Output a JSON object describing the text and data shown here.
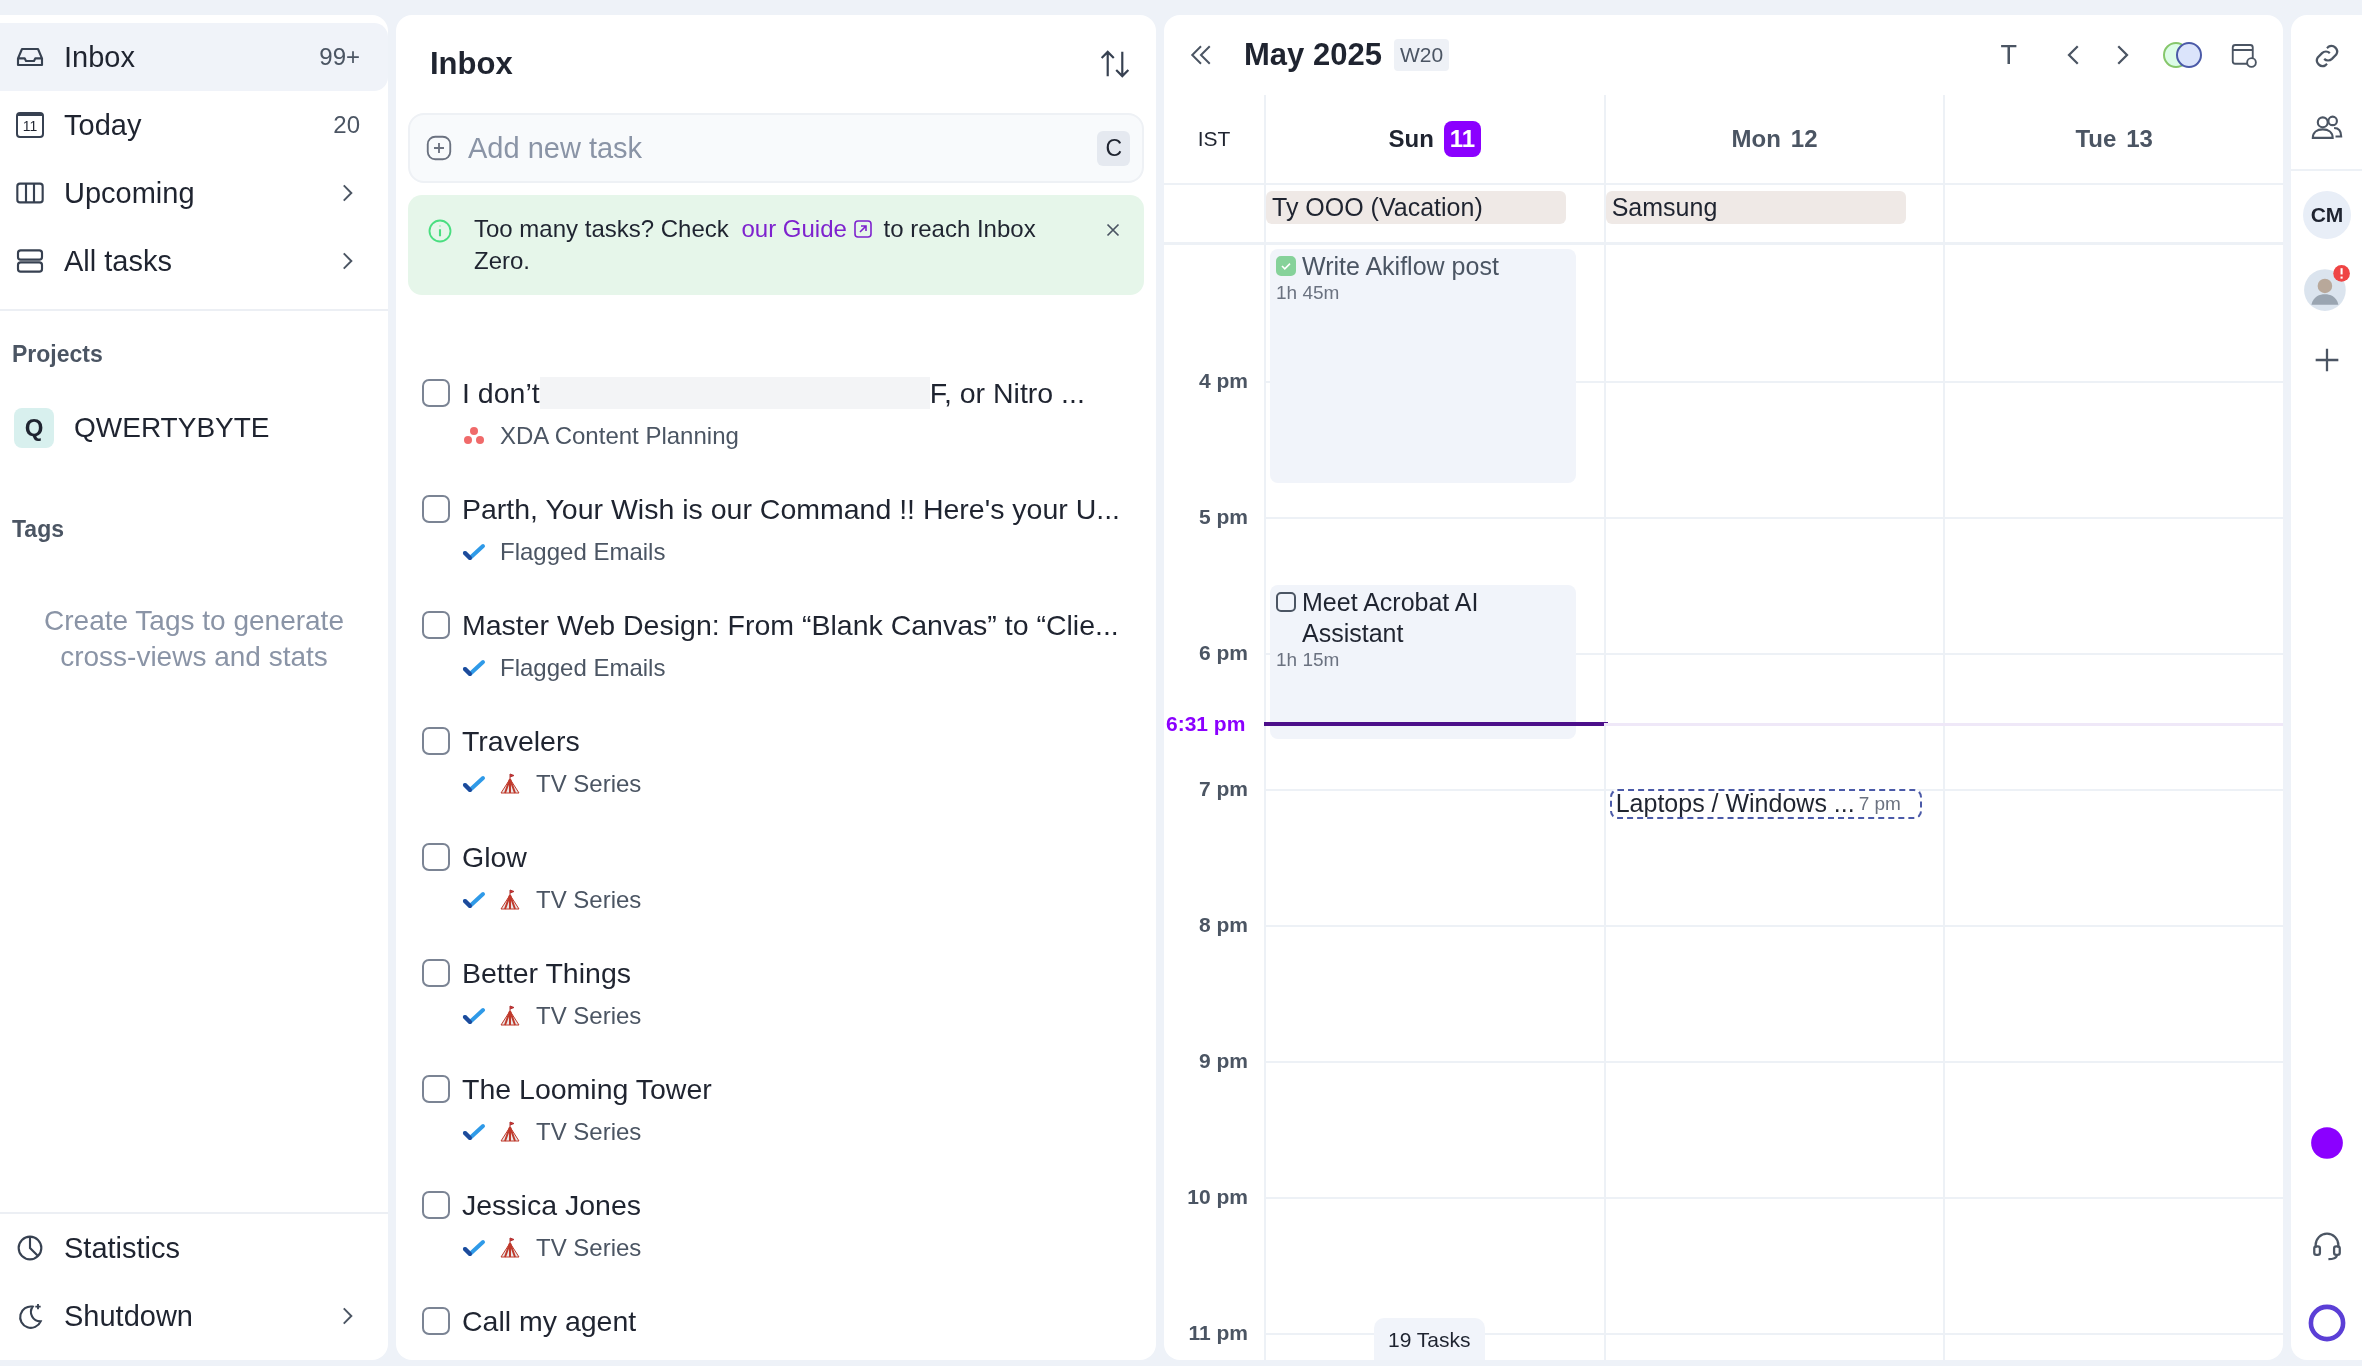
{
  "sidebar": {
    "nav": [
      {
        "label": "Inbox",
        "count": "99+",
        "selected": true
      },
      {
        "label": "Today",
        "icon_text": "11",
        "count": "20",
        "selected": false
      },
      {
        "label": "Upcoming",
        "has_submenu": true,
        "selected": false
      },
      {
        "label": "All tasks",
        "has_submenu": true,
        "selected": false
      }
    ],
    "projects_heading": "Projects",
    "projects": [
      {
        "badge": "Q",
        "name": "QWERTYBYTE"
      }
    ],
    "tags_heading": "Tags",
    "tags_empty": "Create Tags to generate cross-views and stats",
    "footer": [
      {
        "label": "Statistics"
      },
      {
        "label": "Shutdown",
        "has_submenu": true
      }
    ]
  },
  "inbox": {
    "title": "Inbox",
    "add_task": {
      "placeholder": "Add new task",
      "shortcut": "C"
    },
    "banner": {
      "text_before": "Too many tasks? Check ",
      "link": "our Guide",
      "text_after": " to reach Inbox Zero."
    },
    "tasks": [
      {
        "kind": "planning",
        "title": "I don’t",
        "title_end": "F, or Nitro ...",
        "checked": false,
        "project": "XDA Content Planning"
      },
      {
        "kind": "email",
        "title": "Parth, Your Wish is our Command !! Here's your U...",
        "checked": false,
        "project": "Flagged Emails"
      },
      {
        "kind": "email",
        "title": "Master Web Design: From “Blank Canvas” to “Clie...",
        "checked": false,
        "project": "Flagged Emails"
      },
      {
        "kind": "series",
        "title": "Travelers",
        "checked": false,
        "project": "TV Series"
      },
      {
        "kind": "series",
        "title": "Glow",
        "checked": false,
        "project": "TV Series"
      },
      {
        "kind": "series",
        "title": "Better Things",
        "checked": false,
        "project": "TV Series"
      },
      {
        "kind": "series",
        "title": "The Looming Tower",
        "checked": false,
        "project": "TV Series"
      },
      {
        "kind": "series",
        "title": "Jessica Jones",
        "checked": false,
        "project": "TV Series"
      },
      {
        "title": "Call my agent",
        "checked": false
      }
    ]
  },
  "calendar": {
    "title": "May 2025",
    "week": "W20",
    "today_button": "T",
    "timezone": "IST",
    "days": [
      {
        "name": "Sun",
        "date": "11",
        "selected": true,
        "all_day": "Ty OOO (Vacation)",
        "events": [
          {
            "kind": "task",
            "title": "Write Akiflow post",
            "duration": "1h 45m",
            "checked": true
          },
          {
            "kind": "task",
            "title": "Meet Acrobat AI Assistant",
            "duration": "1h 15m",
            "checked": false
          }
        ]
      },
      {
        "name": "Mon",
        "date": "12",
        "selected": false,
        "all_day": "Samsung",
        "events": [
          {
            "kind": "event",
            "title": "Laptops / Windows ...",
            "time": "7 pm"
          }
        ]
      },
      {
        "name": "Tue",
        "date": "13",
        "selected": false
      }
    ],
    "hours": [
      "4 pm",
      "5 pm",
      "6 pm",
      "7 pm",
      "8 pm",
      "9 pm",
      "10 pm",
      "11 pm"
    ],
    "now": "6:31 pm",
    "task_count": "19 Tasks"
  },
  "rail": {
    "avatar_initials": "CM"
  }
}
